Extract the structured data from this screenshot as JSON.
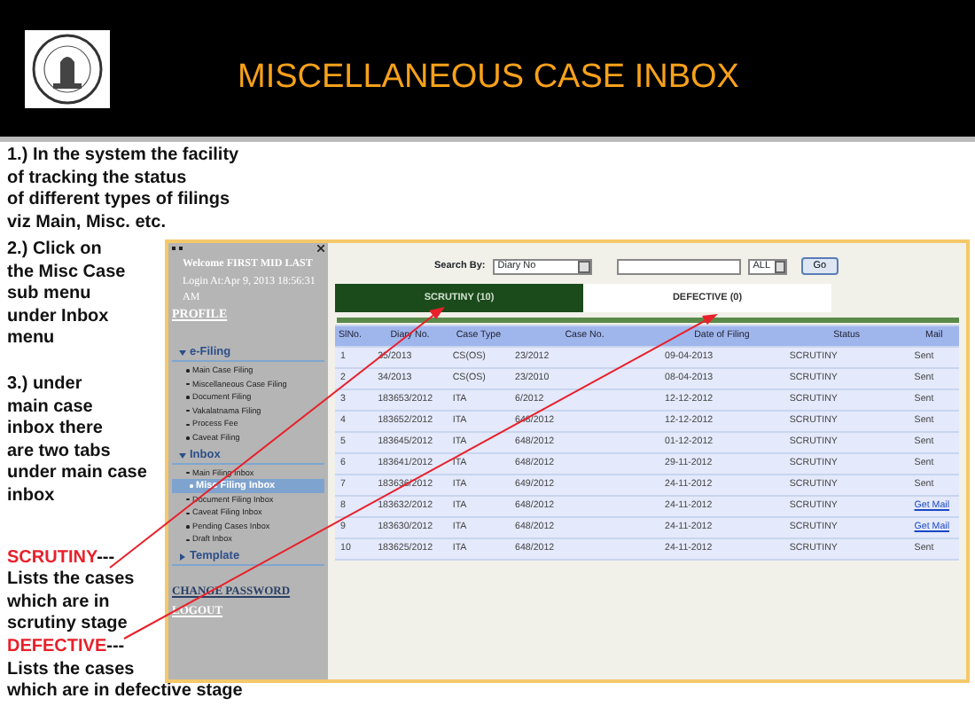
{
  "slide": {
    "title": "MISCELLANEOUS CASE INBOX"
  },
  "notes": [
    {
      "kind": "plain",
      "lines": [
        "1.) In the system the facility",
        "of tracking  the status",
        "of different types of filings",
        "viz  Main, Misc. etc."
      ]
    },
    {
      "kind": "plain",
      "lines": [
        "2.) Click on",
        "the Misc Case",
        " sub menu",
        "under Inbox",
        "menu"
      ]
    },
    {
      "kind": "plain",
      "lines": [
        "3.) under",
        "main case",
        "inbox there",
        "are two tabs",
        "under  main case",
        "inbox"
      ]
    },
    {
      "kind": "term",
      "term": "SCRUTINY",
      "suffix": "---",
      "lines": [
        "Lists the cases",
        "which are in",
        "scrutiny stage"
      ]
    },
    {
      "kind": "term",
      "term": "DEFECTIVE",
      "suffix": "---",
      "lines": [
        "Lists the cases",
        "which are in defective stage"
      ]
    }
  ],
  "sidebar": {
    "welcome": "Welcome  FIRST MID LAST",
    "login": "Login At:Apr 9, 2013 18:56:31 AM",
    "profile": "PROFILE",
    "menus": [
      {
        "label": "e-Filing",
        "expanded": true,
        "children": [
          {
            "label": "Main Case Filing",
            "selected": false
          },
          {
            "label": "Miscellaneous Case Filing",
            "selected": false
          },
          {
            "label": "Document Filing",
            "selected": false
          },
          {
            "label": "Vakalatnama Filing",
            "selected": false
          },
          {
            "label": "Process Fee",
            "selected": false
          },
          {
            "label": "Caveat Filing",
            "selected": false
          }
        ]
      },
      {
        "label": "Inbox",
        "expanded": true,
        "children": [
          {
            "label": "Main Filing Inbox",
            "selected": false
          },
          {
            "label": "Misc Filing Inbox",
            "selected": true
          },
          {
            "label": "Document Filing Inbox",
            "selected": false
          },
          {
            "label": "Caveat Filing Inbox",
            "selected": false
          },
          {
            "label": "Pending Cases Inbox",
            "selected": false
          },
          {
            "label": "Draft Inbox",
            "selected": false
          }
        ]
      },
      {
        "label": "Template",
        "expanded": false
      }
    ],
    "links": [
      "CHANGE PASSWORD",
      "LOGOUT"
    ]
  },
  "search": {
    "label": "Search By:",
    "field": "Diary No",
    "filter": "ALL",
    "button": "Go"
  },
  "tabs": [
    {
      "label": "SCRUTINY (10)",
      "selected": true
    },
    {
      "label": "DEFECTIVE (0)",
      "selected": false
    }
  ],
  "table": {
    "columns": [
      "SlNo.",
      "Diary No.",
      "Case Type",
      "Case No.",
      "Date of Filing",
      "Status",
      "Mail"
    ],
    "rows": [
      {
        "cells": [
          "1",
          "35/2013",
          "CS(OS)",
          "23/2012",
          "09-04-2013",
          "SCRUTINY"
        ],
        "mail": {
          "kind": "text",
          "text": "Sent"
        }
      },
      {
        "cells": [
          "2",
          "34/2013",
          "CS(OS)",
          "23/2010",
          "08-04-2013",
          "SCRUTINY"
        ],
        "mail": {
          "kind": "text",
          "text": "Sent"
        }
      },
      {
        "cells": [
          "3",
          "183653/2012",
          "ITA",
          "6/2012",
          "12-12-2012",
          "SCRUTINY"
        ],
        "mail": {
          "kind": "text",
          "text": "Sent"
        }
      },
      {
        "cells": [
          "4",
          "183652/2012",
          "ITA",
          "648/2012",
          "12-12-2012",
          "SCRUTINY"
        ],
        "mail": {
          "kind": "text",
          "text": "Sent"
        }
      },
      {
        "cells": [
          "5",
          "183645/2012",
          "ITA",
          "648/2012",
          "01-12-2012",
          "SCRUTINY"
        ],
        "mail": {
          "kind": "text",
          "text": "Sent"
        }
      },
      {
        "cells": [
          "6",
          "183641/2012",
          "ITA",
          "648/2012",
          "29-11-2012",
          "SCRUTINY"
        ],
        "mail": {
          "kind": "text",
          "text": "Sent"
        }
      },
      {
        "cells": [
          "7",
          "183636/2012",
          "ITA",
          "649/2012",
          "24-11-2012",
          "SCRUTINY"
        ],
        "mail": {
          "kind": "text",
          "text": "Sent"
        }
      },
      {
        "cells": [
          "8",
          "183632/2012",
          "ITA",
          "648/2012",
          "24-11-2012",
          "SCRUTINY"
        ],
        "mail": {
          "kind": "link",
          "text": "Get Mail"
        }
      },
      {
        "cells": [
          "9",
          "183630/2012",
          "ITA",
          "648/2012",
          "24-11-2012",
          "SCRUTINY"
        ],
        "mail": {
          "kind": "link",
          "text": "Get Mail"
        }
      },
      {
        "cells": [
          "10",
          "183625/2012",
          "ITA",
          "648/2012",
          "24-11-2012",
          "SCRUTINY"
        ],
        "mail": {
          "kind": "text",
          "text": "Sent"
        }
      }
    ]
  }
}
